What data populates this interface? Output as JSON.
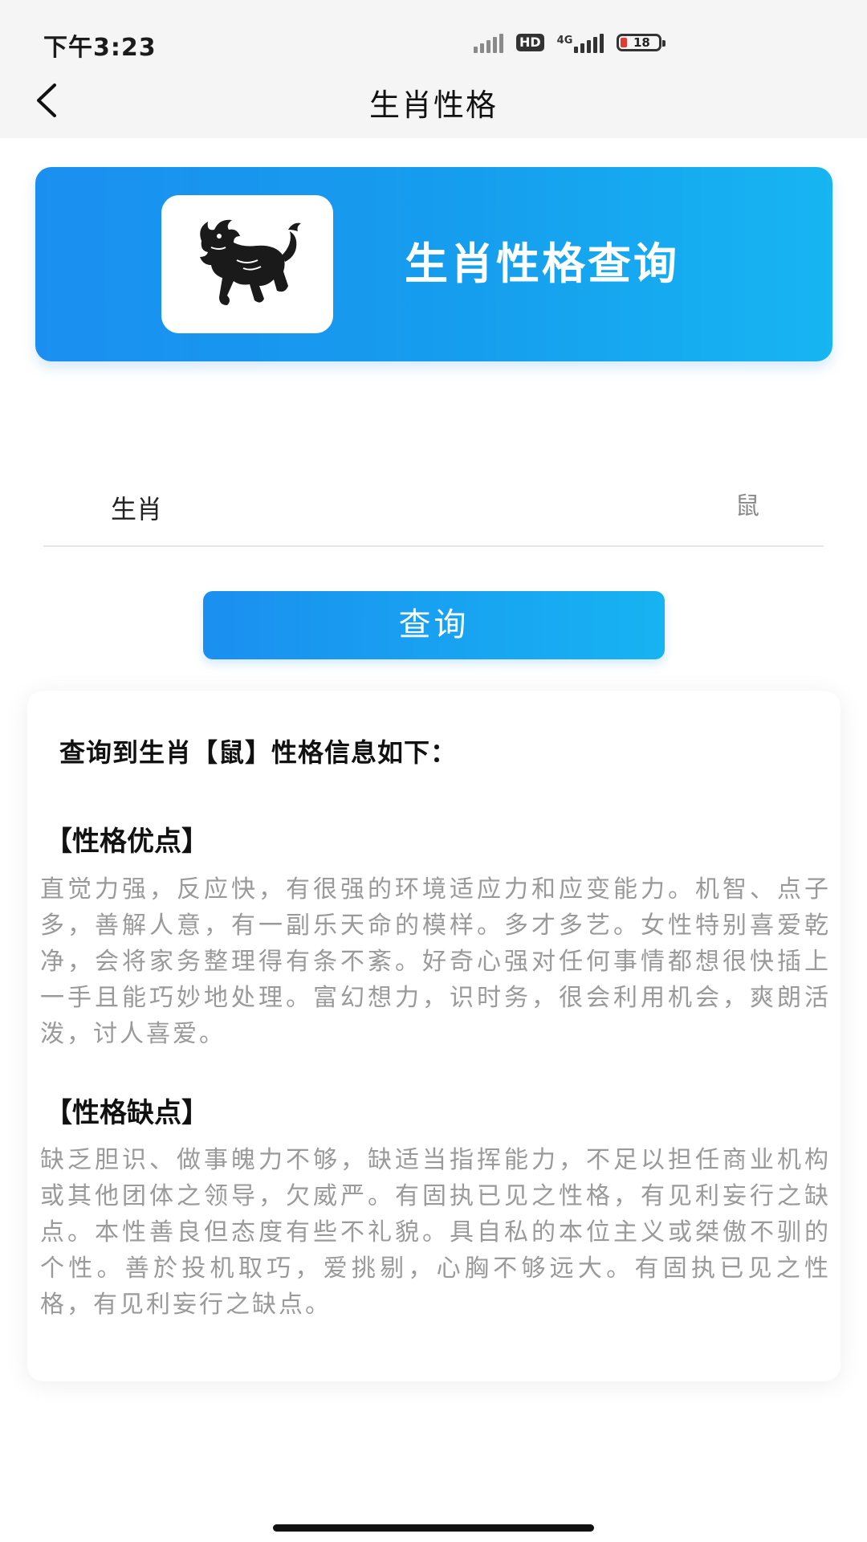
{
  "status_bar": {
    "time": "下午3:23",
    "network": "4G",
    "battery": "18",
    "icons": [
      "signal-icon",
      "hd-icon",
      "network-4g-icon",
      "battery-icon"
    ]
  },
  "nav": {
    "back_icon": "chevron-left-icon",
    "title": "生肖性格"
  },
  "banner": {
    "logo_icon": "qilin-logo-icon",
    "title": "生肖性格查询"
  },
  "form": {
    "label": "生肖",
    "value": "鼠"
  },
  "query_button": {
    "label": "查询"
  },
  "result": {
    "heading": "查询到生肖【鼠】性格信息如下：",
    "strengths_title": "【性格优点】",
    "strengths_text": "直觉力强，反应快，有很强的环境适应力和应变能力。机智、点子多，善解人意，有一副乐天命的模样。多才多艺。女性特别喜爱乾净，会将家务整理得有条不紊。好奇心强对任何事情都想很快插上一手且能巧妙地处理。富幻想力，识时务，很会利用机会，爽朗活泼，讨人喜爱。",
    "weaknesses_title": "【性格缺点】",
    "weaknesses_text": "缺乏胆识、做事魄力不够，缺适当指挥能力，不足以担任商业机构或其他团体之领导，欠威严。有固执已见之性格，有见利妄行之缺点。本性善良但态度有些不礼貌。具自私的本位主义或桀傲不驯的个性。善於投机取巧，爱挑剔，心胸不够远大。有固执已见之性格，有见利妄行之缺点。"
  },
  "colors": {
    "accent_start": "#1a8ff0",
    "accent_end": "#17b5f2",
    "battery_low": "#e53935",
    "body_text": "#9a9a9a"
  }
}
